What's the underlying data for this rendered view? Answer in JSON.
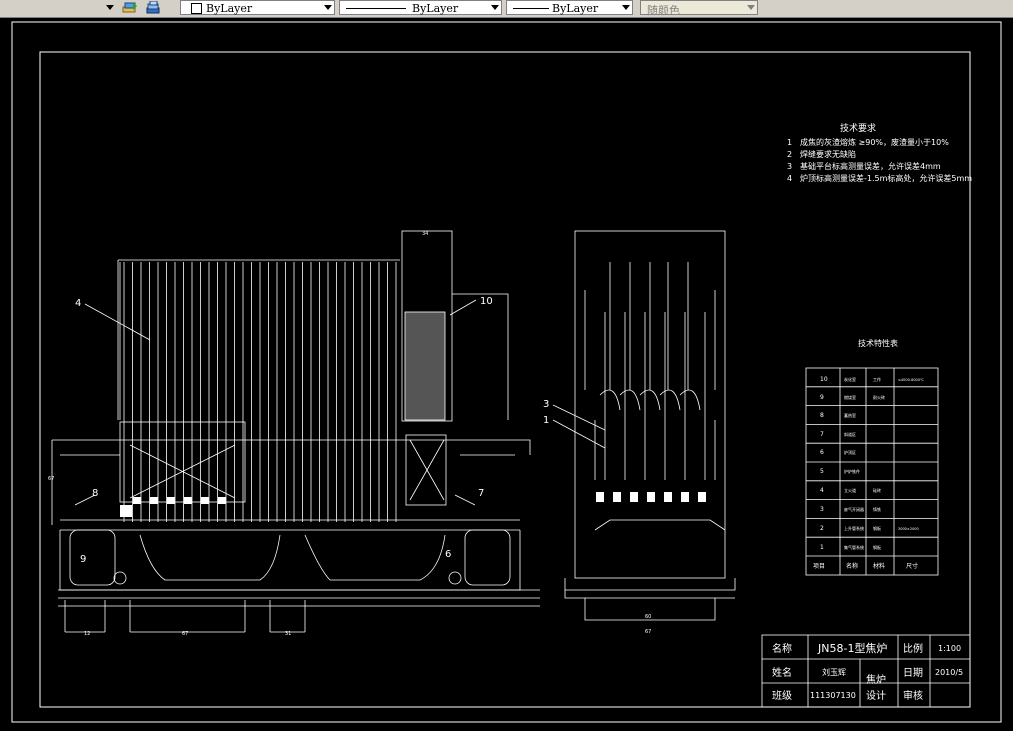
{
  "toolbar": {
    "layer_label": "ByLayer",
    "linetype_label": "ByLayer",
    "lineweight_label": "ByLayer",
    "color_label": "随颜色"
  },
  "drawing": {
    "tech_req_title": "技术要求",
    "tech_req": [
      {
        "num": "1",
        "text": "成焦的灰渣熔炼 ≥90%，废渣量小于10%"
      },
      {
        "num": "2",
        "text": "焊缝要求无缺陷"
      },
      {
        "num": "3",
        "text": "基础平台标高测量误差，允许误差4mm"
      },
      {
        "num": "4",
        "text": "炉顶标高测量误差-1.5m标高处，允许误差5mm"
      }
    ],
    "params_title": "技术特性表",
    "params_rows": [
      {
        "no": "10",
        "name": "炭化室",
        "mat": "工作",
        "unit": "≤4000-6000℃"
      },
      {
        "no": "9",
        "name": "燃烧室",
        "mat": "耐火砖",
        "unit": ""
      },
      {
        "no": "8",
        "name": "蓄热室",
        "mat": "",
        "unit": ""
      },
      {
        "no": "7",
        "name": "斜道区",
        "mat": "",
        "unit": ""
      },
      {
        "no": "6",
        "name": "炉顶区",
        "mat": "",
        "unit": ""
      },
      {
        "no": "5",
        "name": "护炉铁件",
        "mat": "",
        "unit": ""
      },
      {
        "no": "4",
        "name": "立火道",
        "mat": "硅砖",
        "unit": ""
      },
      {
        "no": "3",
        "name": "废气开闭器",
        "mat": "铸铁",
        "unit": ""
      },
      {
        "no": "2",
        "name": "上升管系统",
        "mat": "钢板",
        "unit": "3000×2000"
      },
      {
        "no": "1",
        "name": "集气管系统",
        "mat": "钢板",
        "unit": ""
      }
    ],
    "params_footer": [
      "项目",
      "名称",
      "材料",
      "尺寸"
    ],
    "title_block": {
      "name_label": "名称",
      "name_value": "JN58-1型焦炉",
      "scale_label": "比例",
      "scale_value": "1:100",
      "author_label": "姓名",
      "author_value": "刘玉辉",
      "subject_value": "焦炉",
      "date_label": "日期",
      "date_value": "2010/5",
      "class_label": "班级",
      "class_value": "111307130",
      "design_label": "设计",
      "review_label": "审核"
    },
    "callouts": [
      "4",
      "10",
      "8",
      "7",
      "9",
      "6",
      "3",
      "1"
    ],
    "dims": [
      "34",
      "67",
      "12",
      "67",
      "31",
      "60",
      "67"
    ]
  }
}
